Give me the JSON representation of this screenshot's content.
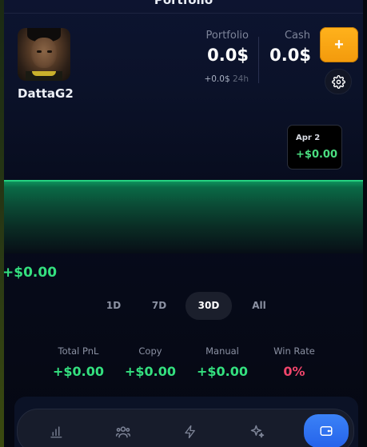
{
  "header": {
    "title": "Portfolio"
  },
  "profile": {
    "username": "DattaG2"
  },
  "summary": {
    "portfolio_label": "Portfolio",
    "portfolio_value": "0.0$",
    "portfolio_change": "+0.0$",
    "portfolio_change_period": "24h",
    "cash_label": "Cash",
    "cash_value": "0.0$",
    "add_label": "+"
  },
  "tooltip": {
    "date": "Apr 2",
    "value": "+$0.00"
  },
  "chart_data": {
    "type": "area",
    "series": [
      {
        "values": [
          0,
          0
        ]
      }
    ],
    "title": "",
    "xlabel": "",
    "ylabel": "",
    "line_color": "#25d07f"
  },
  "pnl_value": "+$0.00",
  "ranges": {
    "items": [
      "1D",
      "7D",
      "30D",
      "All"
    ],
    "selected": "30D"
  },
  "metrics": [
    {
      "label": "Total PnL",
      "value": "+$0.00"
    },
    {
      "label": "Copy",
      "value": "+$0.00"
    },
    {
      "label": "Manual",
      "value": "+$0.00"
    },
    {
      "label": "Win Rate",
      "value": "0%"
    }
  ],
  "nav": {
    "items": [
      {
        "icon": "bar-chart-icon"
      },
      {
        "icon": "users-icon"
      },
      {
        "icon": "lightning-icon"
      },
      {
        "icon": "sparkle-icon"
      },
      {
        "icon": "wallet-icon",
        "active": true
      }
    ]
  },
  "colors": {
    "accent_green": "#34e07f",
    "accent_orange": "#f7a413",
    "accent_blue": "#2f6ff0",
    "negative_red": "#f0456b"
  }
}
